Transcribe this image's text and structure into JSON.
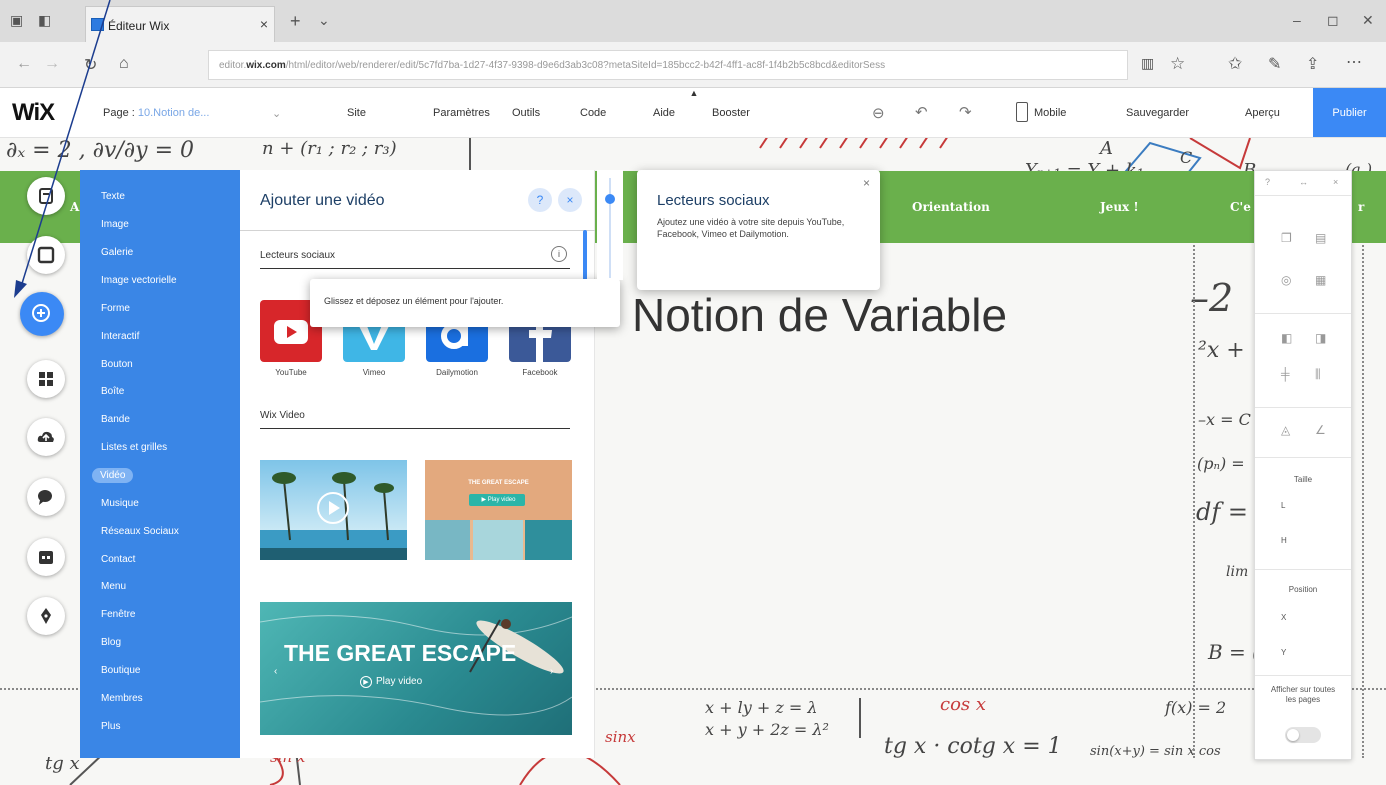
{
  "browser": {
    "tab_title": "Éditeur Wix",
    "url_domain": "wix.com",
    "url_prefix": "editor.",
    "url_rest": "/html/editor/web/renderer/edit/5c7fd7ba-1d27-4f37-9398-d9e6d3ab3c08?metaSiteId=185bcc2-b42f-4ff1-ac8f-1f4b2b5c8bcd&editorSess",
    "window_controls": [
      "–",
      "◻",
      "✕"
    ]
  },
  "wix_toolbar": {
    "logo": "WiX",
    "page_label": "Page : ",
    "page_value": "10.Notion de...",
    "menus": [
      "Site",
      "Paramètres",
      "Outils",
      "Code",
      "Aide",
      "Booster"
    ],
    "mobile_label": "Mobile",
    "save_label": "Sauvegarder",
    "preview_label": "Aperçu",
    "publish_label": "Publier"
  },
  "site": {
    "nav_links": [
      "Orientation",
      "Jeux !",
      "C'e"
    ],
    "nav_partial_left": "A",
    "nav_partial_right": "r",
    "heading": "Notion de Variable"
  },
  "add_panel": {
    "categories": [
      "Texte",
      "Image",
      "Galerie",
      "Image vectorielle",
      "Forme",
      "Interactif",
      "Bouton",
      "Boîte",
      "Bande",
      "Listes et grilles",
      "Vidéo",
      "Musique",
      "Réseaux Sociaux",
      "Contact",
      "Menu",
      "Fenêtre",
      "Blog",
      "Boutique",
      "Membres",
      "Plus"
    ],
    "selected_category": "Vidéo",
    "title": "Ajouter une vidéo",
    "help_btn": "?",
    "close_btn": "×",
    "section_social": "Lecteurs sociaux",
    "info_icon": "i",
    "social_players": [
      "YouTube",
      "Vimeo",
      "Dailymotion",
      "Facebook"
    ],
    "section_wix": "Wix Video",
    "thumb_text_1": "THE GREAT ESCAPE",
    "thumb_btn_1": "▶ Play video",
    "big_thumb_title": "THE GREAT ESCAPE",
    "big_thumb_btn": "Play video",
    "tooltip": "Glissez et déposez un élément pour l'ajouter."
  },
  "popover": {
    "title": "Lecteurs sociaux",
    "body": "Ajoutez une vidéo à votre site depuis YouTube, Facebook, Vimeo et Dailymotion.",
    "close": "×"
  },
  "right_toolbar": {
    "top_controls": [
      "?",
      "↔",
      "×"
    ],
    "taille": "Taille",
    "w": "L",
    "h": "H",
    "position": "Position",
    "x": "X",
    "y": "Y",
    "show_all": "Afficher sur toutes les pages"
  },
  "math_texts": {
    "t1": "∂ₓ = 2 , ∂v/∂y = 0",
    "t2": "n + (r₁ ; r₂ ; r₃)",
    "t3": "Yₙ₊₁ = Y + k₁",
    "t4": "–2",
    "t5": "²x +",
    "t6": "–x = C",
    "t7": "(pₙ) = ",
    "t8": "df =",
    "t9": "lim",
    "t10": "B = (",
    "t11": "f(x) = 2",
    "t12": "x + ly + z = λ",
    "t13": "x + y + 2z = λ²",
    "t14": "cos x",
    "t15": "tg x · cotg x = 1",
    "t16": "sin(x+y) = sin x cos",
    "t17": "sin x",
    "t18": "tg x",
    "t19": "A",
    "t20": "B",
    "t21": "C",
    "t22": "sinx",
    "t23": "(a,)"
  }
}
